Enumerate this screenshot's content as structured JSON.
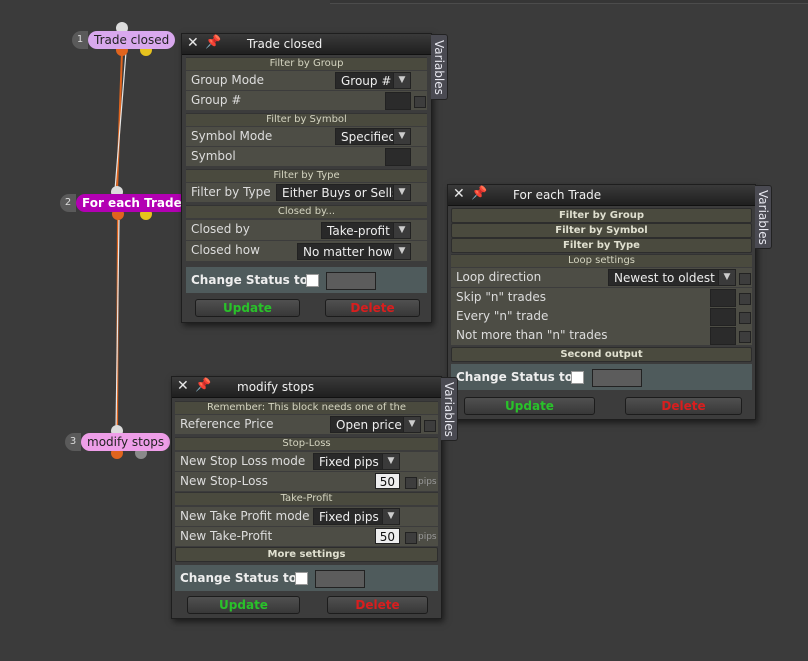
{
  "nodes": [
    {
      "num": "1",
      "label": "Trade closed"
    },
    {
      "num": "2",
      "label": "For each Trade"
    },
    {
      "num": "3",
      "label": "modify stops"
    }
  ],
  "variables_tab": "Variables",
  "panel_trade_closed": {
    "title": "Trade closed",
    "sec_group": "Filter by Group",
    "group_mode_label": "Group Mode",
    "group_mode_value": "Group #",
    "group_num_label": "Group #",
    "sec_symbol": "Filter by Symbol",
    "symbol_mode_label": "Symbol Mode",
    "symbol_mode_value": "Specified",
    "symbol_label": "Symbol",
    "sec_type": "Filter by Type",
    "filter_type_label": "Filter by Type",
    "filter_type_value": "Either Buys or Sells",
    "sec_closed": "Closed by...",
    "closed_by_label": "Closed by",
    "closed_by_value": "Take-profit",
    "closed_how_label": "Closed how",
    "closed_how_value": "No matter how",
    "status_label": "Change Status to",
    "update_label": "Update",
    "delete_label": "Delete"
  },
  "panel_for_each": {
    "title": "For each Trade",
    "sec_group": "Filter by Group",
    "sec_symbol": "Filter by Symbol",
    "sec_type": "Filter by Type",
    "sec_loop": "Loop settings",
    "loop_direction_label": "Loop direction",
    "loop_direction_value": "Newest to oldest",
    "skip_label": "Skip \"n\" trades",
    "every_label": "Every \"n\" trade",
    "not_more_label": "Not more than \"n\" trades",
    "sec_second": "Second output",
    "status_label": "Change Status to",
    "update_label": "Update",
    "delete_label": "Delete"
  },
  "panel_modify": {
    "title": "modify stops",
    "sec_remember": "Remember: This block needs one of the",
    "ref_price_label": "Reference Price",
    "ref_price_value": "Open price",
    "sec_sl": "Stop-Loss",
    "sl_mode_label": "New Stop Loss mode",
    "sl_mode_value": "Fixed pips",
    "sl_label": "New Stop-Loss",
    "sl_value": "50",
    "sl_unit": "pips",
    "sec_tp": "Take-Profit",
    "tp_mode_label": "New Take Profit mode",
    "tp_mode_value": "Fixed pips",
    "tp_label": "New Take-Profit",
    "tp_value": "50",
    "tp_unit": "pips",
    "sec_more": "More settings",
    "status_label": "Change Status to",
    "update_label": "Update",
    "delete_label": "Delete"
  },
  "colors": {
    "node1": "#d9a8ee",
    "node2": "#b300b3",
    "node3": "#ee9ee8",
    "wire_orange": "#e0641e",
    "update": "#29c22a",
    "delete": "#d81e1e"
  },
  "icons": {
    "close": "close-icon",
    "pin": "pin-icon",
    "dropdown": "chevron-down-icon"
  }
}
